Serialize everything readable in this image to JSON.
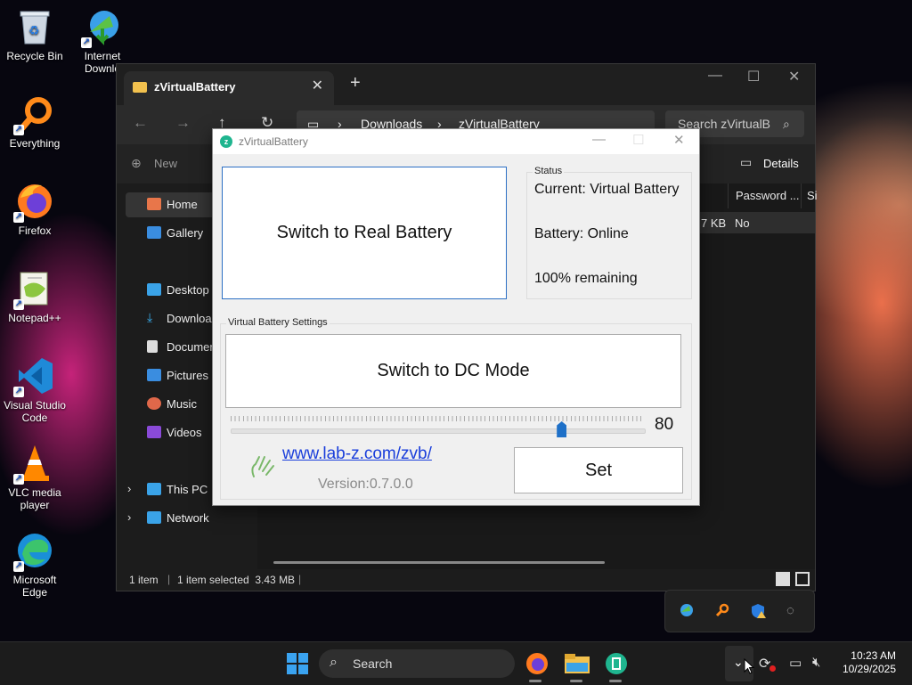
{
  "desktop": {
    "icons": [
      {
        "label": "Recycle Bin"
      },
      {
        "label": "Internet Downlo"
      },
      {
        "label": "Everything"
      },
      {
        "label": "Firefox"
      },
      {
        "label": "Notepad++"
      },
      {
        "label": "Visual Studio Code"
      },
      {
        "label": "VLC media player"
      },
      {
        "label": "Microsoft Edge"
      }
    ]
  },
  "explorer": {
    "tab_title": "zVirtualBattery",
    "breadcrumb": [
      "Downloads",
      "zVirtualBattery"
    ],
    "search_placeholder": "Search zVirtualB",
    "new_label": "New",
    "details_label": "Details",
    "columns": [
      "Password ...",
      "Si"
    ],
    "row": {
      "size_partial": "7 KB",
      "password": "No"
    },
    "sidebar": [
      {
        "label": "Home"
      },
      {
        "label": "Gallery"
      },
      {
        "label": "Desktop"
      },
      {
        "label": "Download"
      },
      {
        "label": "Documen"
      },
      {
        "label": "Pictures"
      },
      {
        "label": "Music"
      },
      {
        "label": "Videos"
      },
      {
        "label": "This PC"
      },
      {
        "label": "Network"
      }
    ],
    "status": {
      "items": "1 item",
      "selected": "1 item selected  3.43 MB"
    }
  },
  "app": {
    "title": "zVirtualBattery",
    "switch_battery_label": "Switch to Real Battery",
    "status_group_label": "Status",
    "status_current": "Current: Virtual Battery",
    "status_battery": "Battery: Online",
    "status_remaining": "100% remaining",
    "settings_group_label": "Virtual Battery Settings",
    "switch_mode_label": "Switch to DC Mode",
    "slider_value": "80",
    "slider_fraction": 0.8,
    "link": "www.lab-z.com/zvb/",
    "version": "Version:0.7.0.0",
    "set_label": "Set"
  },
  "taskbar": {
    "search_label": "Search",
    "time": "10:23 AM",
    "date": "10/29/2025"
  },
  "colors": {
    "accent": "#1e70c8",
    "link": "#1a3edb",
    "app_icon": "#1fb58f"
  }
}
